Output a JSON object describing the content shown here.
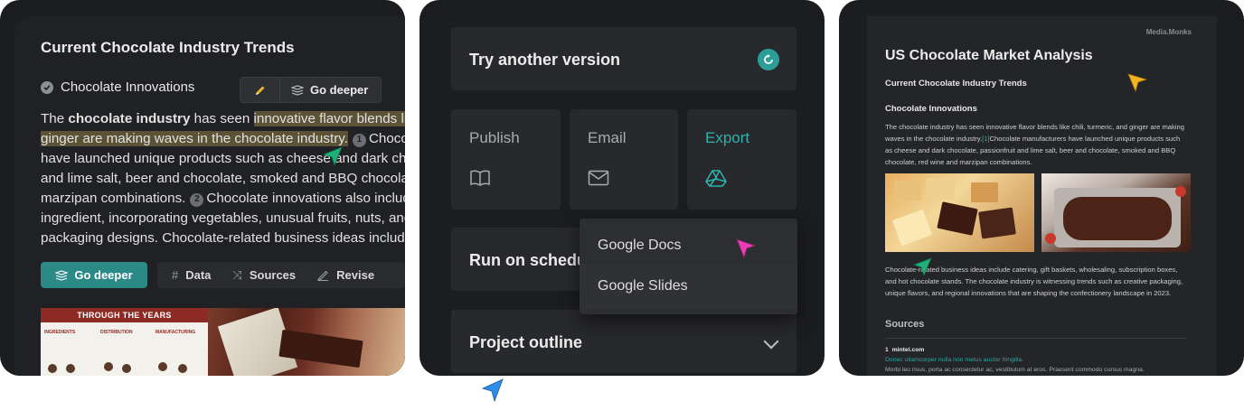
{
  "panel1": {
    "title": "Current Chocolate Industry Trends",
    "subtitle": "Chocolate Innovations",
    "toolbar": {
      "go_deeper": "Go deeper"
    },
    "body": {
      "l1_a": "The ",
      "l1_bold": "chocolate industry",
      "l1_b": " has seen ",
      "l1_hl": "innovative flavor blends lik",
      "l2_hl": "ginger are making waves in the chocolate industry.",
      "ref1": "1",
      "l2_tail": "Choco",
      "l3": "have launched unique products such as cheese and dark cho",
      "l4": "and lime salt, beer and chocolate, smoked and BBQ chocolat",
      "l5_a": "marzipan combinations.",
      "ref2": "2",
      "l5_b": "Chocolate innovations also includ",
      "l6": "ingredient, incorporating vegetables, unusual fruits, nuts, and",
      "l7": "packaging designs. Chocolate-related business ideas includ"
    },
    "actions": {
      "go_deeper": "Go deeper",
      "data": "Data",
      "sources": "Sources",
      "revise": "Revise"
    },
    "infographic_title": "THROUGH THE YEARS",
    "infographic_cols": [
      "INGREDIENTS",
      "DISTRIBUTION",
      "MANUFACTURING"
    ]
  },
  "panel2": {
    "try_another": "Try another version",
    "tiles": {
      "publish": "Publish",
      "email": "Email",
      "export": "Export"
    },
    "run_on_schedule": "Run on schedu",
    "dropdown": [
      "Google Docs",
      "Google Slides"
    ],
    "project_outline": "Project outline"
  },
  "panel3": {
    "brand": "Media.Monks",
    "title": "US Chocolate Market Analysis",
    "h_trends": "Current Chocolate Industry Trends",
    "h_innovations": "Chocolate Innovations",
    "para1_lines": [
      "The chocolate industry has seen innovative flavor blends like chili, turmeric, and ginger are making",
      "waves in the chocolate industry.",
      "Chocolate manufacturers have launched unique products such",
      "as cheese and dark chocolate, passionfruit and lime salt, beer and chocolate, smoked and BBQ",
      "chocolate, red wine and marzipan combinations."
    ],
    "citation": "[1]",
    "para2_lines": [
      "Chocolate-related business ideas include catering, gift baskets, wholesaling, subscription boxes,",
      "and hot chocolate stands. The chocolate industry is witnessing trends such as creative packaging,",
      "unique flavors, and regional innovations that are shaping the confectionery landscape in 2023."
    ],
    "sources_heading": "Sources",
    "source_num": "1",
    "source_domain": "mintel.com",
    "source_link": "Donec ullamcorper nulla non metus auctor fringilla.",
    "source_desc": "Morbi leo risus, porta ac consectetur ac, vestibulum at eros. Praesent commodo cursus magna."
  },
  "colors": {
    "accent_teal": "#2c8a86",
    "highlight": "#5c5236",
    "cursor_green": "#1fb07a",
    "cursor_pink": "#e83fb5",
    "cursor_yellow": "#f2b51f",
    "cursor_blue": "#2f8fe6"
  }
}
